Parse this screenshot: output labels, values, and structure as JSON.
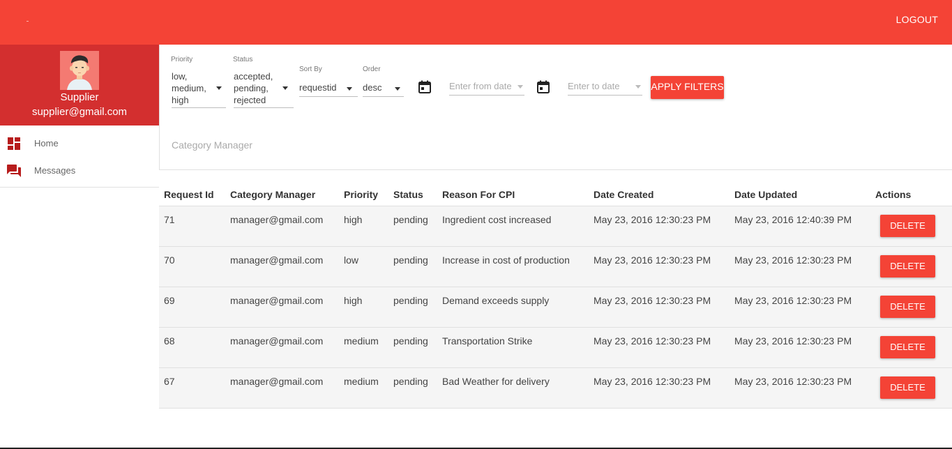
{
  "header": {
    "logout_label": "LOGOUT",
    "accent": "#f44336"
  },
  "profile": {
    "role": "Supplier",
    "email": "supplier@gmail.com",
    "bg": "#d32f2f"
  },
  "nav": {
    "items": [
      {
        "label": "Home",
        "icon": "dashboard-icon"
      },
      {
        "label": "Messages",
        "icon": "forum-icon"
      }
    ]
  },
  "filters": {
    "priority": {
      "label": "Priority",
      "line1": "low,",
      "line2": "medium,",
      "line3": "high"
    },
    "status": {
      "label": "Status",
      "line1": "accepted,",
      "line2": "pending,",
      "line3": "rejected"
    },
    "sort_by": {
      "label": "Sort By",
      "value": "requestid"
    },
    "order": {
      "label": "Order",
      "value": "desc"
    },
    "from_date": {
      "placeholder": "Enter from date"
    },
    "to_date": {
      "placeholder": "Enter to date"
    },
    "apply_label": "APPLY FILTERS",
    "category_manager_placeholder": "Category Manager"
  },
  "table": {
    "headers": [
      "Request Id",
      "Category Manager",
      "Priority",
      "Status",
      "Reason For CPI",
      "Date Created",
      "Date Updated",
      "Actions"
    ],
    "delete_label": "DELETE",
    "rows": [
      [
        "71",
        "manager@gmail.com",
        "high",
        "pending",
        "Ingredient cost increased",
        "May 23, 2016 12:30:23 PM",
        "May 23, 2016 12:40:39 PM"
      ],
      [
        "70",
        "manager@gmail.com",
        "low",
        "pending",
        "Increase in cost of production",
        "May 23, 2016 12:30:23 PM",
        "May 23, 2016 12:30:23 PM"
      ],
      [
        "69",
        "manager@gmail.com",
        "high",
        "pending",
        "Demand exceeds supply",
        "May 23, 2016 12:30:23 PM",
        "May 23, 2016 12:30:23 PM"
      ],
      [
        "68",
        "manager@gmail.com",
        "medium",
        "pending",
        "Transportation Strike",
        "May 23, 2016 12:30:23 PM",
        "May 23, 2016 12:30:23 PM"
      ],
      [
        "67",
        "manager@gmail.com",
        "medium",
        "pending",
        "Bad Weather for delivery",
        "May 23, 2016 12:30:23 PM",
        "May 23, 2016 12:30:23 PM"
      ]
    ]
  }
}
